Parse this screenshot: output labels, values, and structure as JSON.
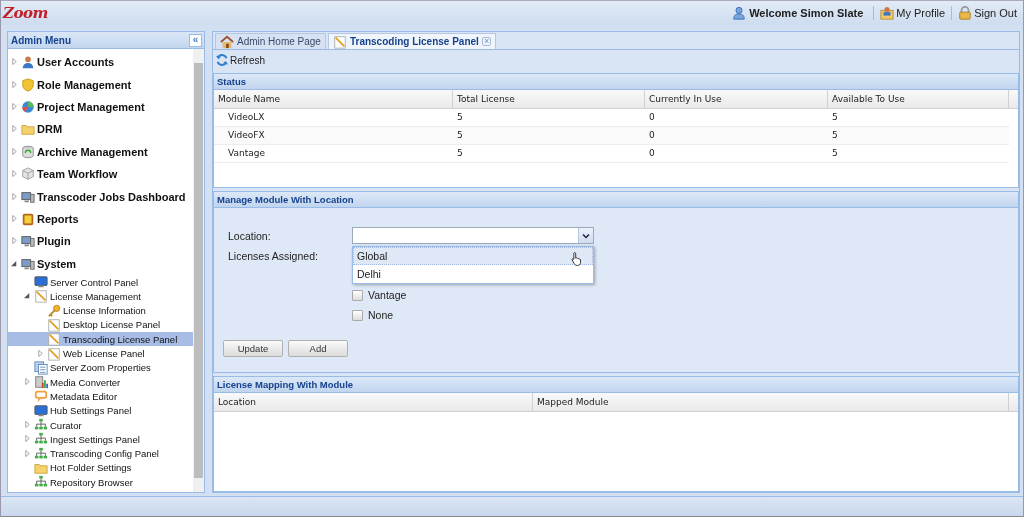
{
  "header": {
    "logo": "Zoom",
    "welcome": "Welcome Simon Slate",
    "links": [
      {
        "label": "My Profile",
        "kind": "profile"
      },
      {
        "label": "Sign Out",
        "kind": "lock"
      }
    ]
  },
  "sidebar": {
    "title": "Admin Menu",
    "collapse_glyph": "«",
    "items": [
      {
        "label": "User Accounts",
        "kind": "user",
        "expanded": false,
        "selected": false
      },
      {
        "label": "Role Management",
        "kind": "shield",
        "expanded": false,
        "selected": false
      },
      {
        "label": "Project Management",
        "kind": "chart",
        "expanded": false,
        "selected": false
      },
      {
        "label": "DRM",
        "kind": "folder",
        "expanded": false,
        "selected": false
      },
      {
        "label": "Archive Management",
        "kind": "archive",
        "expanded": false,
        "selected": false
      },
      {
        "label": "Team Workflow",
        "kind": "cube",
        "expanded": false,
        "selected": false
      },
      {
        "label": "Transcoder Jobs Dashboard",
        "kind": "monitor",
        "expanded": false,
        "selected": false
      },
      {
        "label": "Reports",
        "kind": "notebook",
        "expanded": false,
        "selected": false
      },
      {
        "label": "Plugin",
        "kind": "monitor",
        "expanded": false,
        "selected": false
      },
      {
        "label": "System",
        "kind": "monitor",
        "expanded": true,
        "selected": false,
        "children": [
          {
            "label": "Server Control Panel",
            "kind": "screen",
            "selected": false
          },
          {
            "label": "License Management",
            "kind": "pencil",
            "expanded": true,
            "selected": false,
            "children": [
              {
                "label": "License Information",
                "kind": "key",
                "selected": false
              },
              {
                "label": "Desktop License Panel",
                "kind": "pencil",
                "selected": false
              },
              {
                "label": "Transcoding License Panel",
                "kind": "pencil",
                "selected": true
              },
              {
                "label": "Web License Panel",
                "kind": "pencil",
                "expanded": false,
                "selected": false
              }
            ]
          },
          {
            "label": "Server Zoom Properties",
            "kind": "properties",
            "selected": false
          },
          {
            "label": "Media Converter",
            "kind": "media",
            "expanded": false,
            "selected": false
          },
          {
            "label": "Metadata Editor",
            "kind": "editor",
            "selected": false
          },
          {
            "label": "Hub Settings Panel",
            "kind": "screen",
            "selected": false
          },
          {
            "label": "Curator",
            "kind": "network",
            "expanded": false,
            "selected": false
          },
          {
            "label": "Ingest Settings Panel",
            "kind": "network",
            "expanded": false,
            "selected": false
          },
          {
            "label": "Transcoding Config Panel",
            "kind": "network",
            "expanded": false,
            "selected": false
          },
          {
            "label": "Hot Folder Settings",
            "kind": "folder",
            "selected": false
          },
          {
            "label": "Repository Browser",
            "kind": "network",
            "selected": false
          }
        ]
      }
    ]
  },
  "tabs": [
    {
      "label": "Admin Home Page",
      "kind": "home",
      "selected": false
    },
    {
      "label": "Transcoding License Panel",
      "kind": "pencil",
      "selected": true,
      "close_glyph": "×"
    }
  ],
  "toolbar": {
    "refresh": "Refresh"
  },
  "status": {
    "title": "Status",
    "columns": [
      "Module Name",
      "Total License",
      "Currently In Use",
      "Available To Use"
    ],
    "rows": [
      [
        "VideoLX",
        "5",
        "0",
        "5"
      ],
      [
        "VideoFX",
        "5",
        "0",
        "5"
      ],
      [
        "Vantage",
        "5",
        "0",
        "5"
      ]
    ]
  },
  "manage": {
    "title": "Manage Module With Location",
    "location_label": "Location:",
    "licenses_label": "Licenses Assigned:",
    "dropdown_options": [
      {
        "label": "Global",
        "highlighted": true
      },
      {
        "label": "Delhi",
        "highlighted": false
      }
    ],
    "checkboxes": [
      {
        "label": "Vantage",
        "checked": false
      },
      {
        "label": "None",
        "checked": false
      }
    ],
    "buttons": [
      "Update",
      "Add"
    ]
  },
  "mapping": {
    "title": "License Mapping With Module",
    "columns": [
      "Location",
      "Mapped Module"
    ]
  }
}
